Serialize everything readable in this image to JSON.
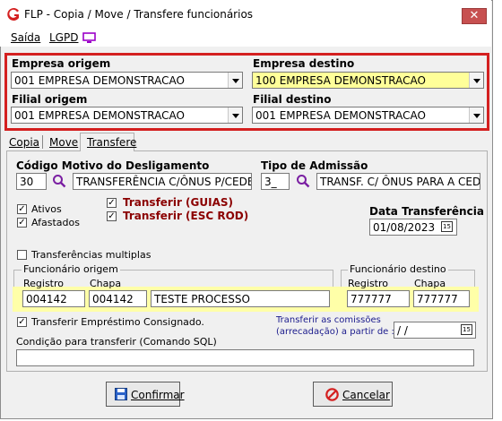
{
  "window": {
    "title": "FLP - Copia / Move / Transfere funcionários",
    "close": "✕"
  },
  "menu": {
    "saida": "Saída",
    "lgpd": "LGPD"
  },
  "empresa_origem": {
    "label": "Empresa origem",
    "value": "001 EMPRESA DEMONSTRACAO"
  },
  "empresa_destino": {
    "label": "Empresa destino",
    "value": "100 EMPRESA DEMONSTRACAO"
  },
  "filial_origem": {
    "label": "Filial origem",
    "value": "001 EMPRESA DEMONSTRACAO"
  },
  "filial_destino": {
    "label": "Filial destino",
    "value": "001 EMPRESA DEMONSTRACAO"
  },
  "tabs": [
    "Copia",
    "Move",
    "Transfere"
  ],
  "motivo": {
    "label": "Código Motivo do Desligamento",
    "code": "30",
    "desc": "TRANSFERÊNCIA C/ÔNUS P/CEDENT"
  },
  "admissao": {
    "label": "Tipo de Admissão",
    "code": "3_",
    "desc": "TRANSF. C/ ÔNUS PARA A CEDEN"
  },
  "checks": {
    "ativos": "Ativos",
    "afastados": "Afastados",
    "guias": "Transferir (GUIAS)",
    "esc_rod": "Transferir (ESC ROD)",
    "multiplas": "Transferências multiplas",
    "emprestimo": "Transferir Empréstimo Consignado.",
    "check_mark": "✓"
  },
  "data_transferencia": {
    "label": "Data Transferência",
    "value": "01/08/2023",
    "cal": "15"
  },
  "func_origem": {
    "title": "Funcionário origem",
    "registro_label": "Registro",
    "chapa_label": "Chapa",
    "registro": "004142",
    "chapa": "004142",
    "nome": "TESTE PROCESSO"
  },
  "func_destino": {
    "title": "Funcionário destino",
    "registro_label": "Registro",
    "chapa_label": "Chapa",
    "registro": "777777",
    "chapa": "777777"
  },
  "comissoes": {
    "line1": "Transferir as comissões",
    "line2": "(arrecadação)  a partir de :",
    "value": " / /",
    "cal": "15"
  },
  "sql": {
    "label": "Condição para transferir (Comando SQL)",
    "value": ""
  },
  "buttons": {
    "confirmar": "Confirmar",
    "cancelar": "Cancelar"
  },
  "colors": {
    "accent_red": "#d42020",
    "highlight_yellow": "#ffff99",
    "maroon": "#8b0000",
    "link_blue": "#1a1a8c"
  }
}
